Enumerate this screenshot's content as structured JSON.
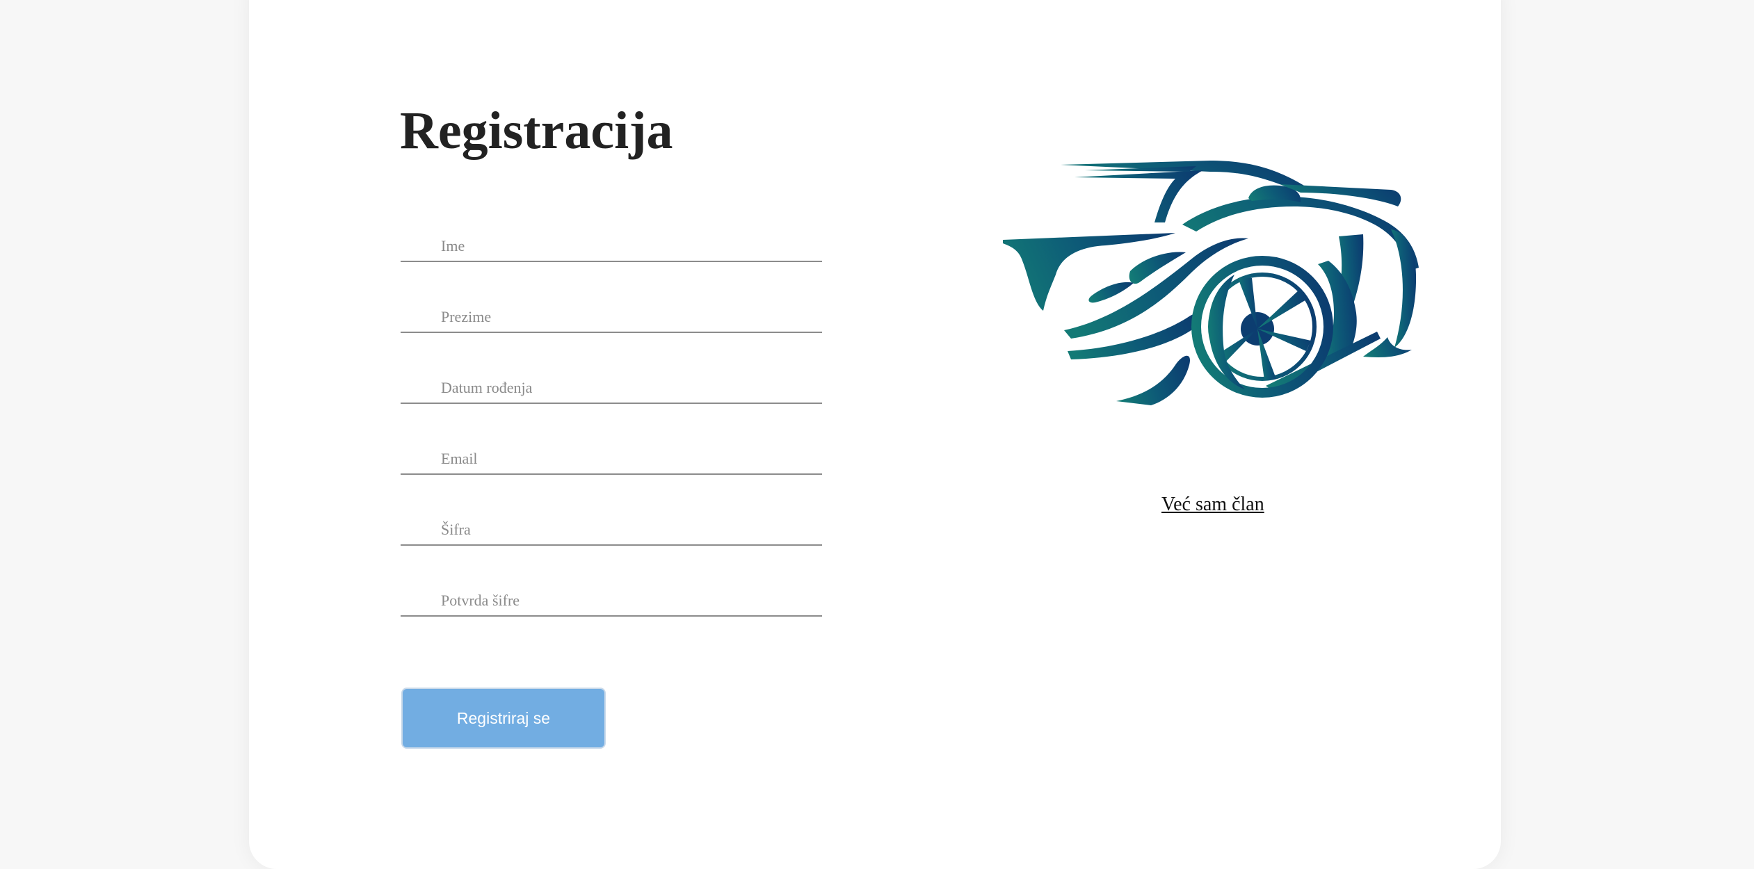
{
  "form": {
    "title": "Registracija",
    "fields": [
      {
        "placeholder": "Ime",
        "value": ""
      },
      {
        "placeholder": "Prezime",
        "value": ""
      },
      {
        "placeholder": "Datum rođenja",
        "value": ""
      },
      {
        "placeholder": "Email",
        "value": ""
      },
      {
        "placeholder": "Šifra",
        "value": ""
      },
      {
        "placeholder": "Potvrda šifre",
        "value": ""
      }
    ],
    "submit_label": "Registriraj se"
  },
  "aside": {
    "logo_icon": "sports-car-logo-icon",
    "member_link": "Već sam član"
  },
  "colors": {
    "background": "#f7f7f7",
    "card": "#ffffff",
    "button": "#72ade2",
    "logo_teal": "#137a76",
    "logo_navy": "#0c3d70"
  }
}
